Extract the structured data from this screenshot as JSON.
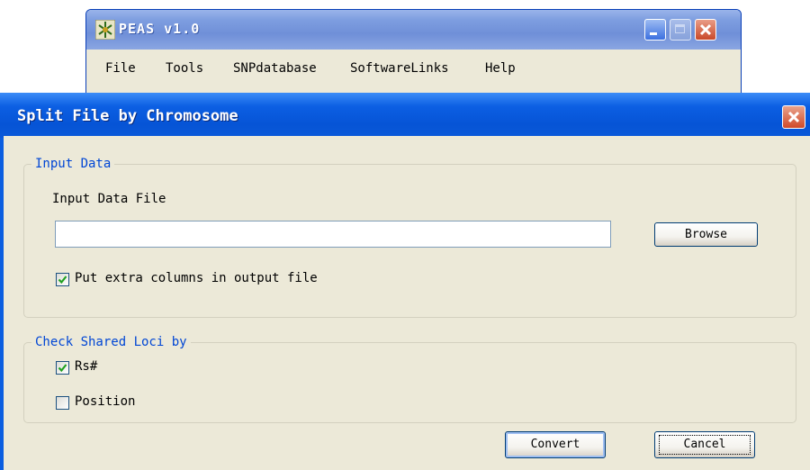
{
  "main_window": {
    "title": "PEAS v1.0",
    "menu": [
      "File",
      "Tools",
      "SNPdatabase",
      "SoftwareLinks",
      "Help"
    ]
  },
  "dialog": {
    "title": "Split File by Chromosome",
    "input_group": {
      "legend": "Input Data",
      "file_label": "Input Data File",
      "file_value": "",
      "browse_label": "Browse",
      "extra_columns_label": "Put extra columns in output file",
      "extra_columns_checked": true
    },
    "shared_loci_group": {
      "legend": "Check Shared Loci by",
      "rs_label": "Rs#",
      "rs_checked": true,
      "position_label": "Position",
      "position_checked": false
    },
    "convert_label": "Convert",
    "cancel_label": "Cancel"
  },
  "colors": {
    "titlebar_blue": "#0b5ee0",
    "group_legend": "#0046d5",
    "window_face": "#ece9d8",
    "close_red": "#d04a2a"
  }
}
